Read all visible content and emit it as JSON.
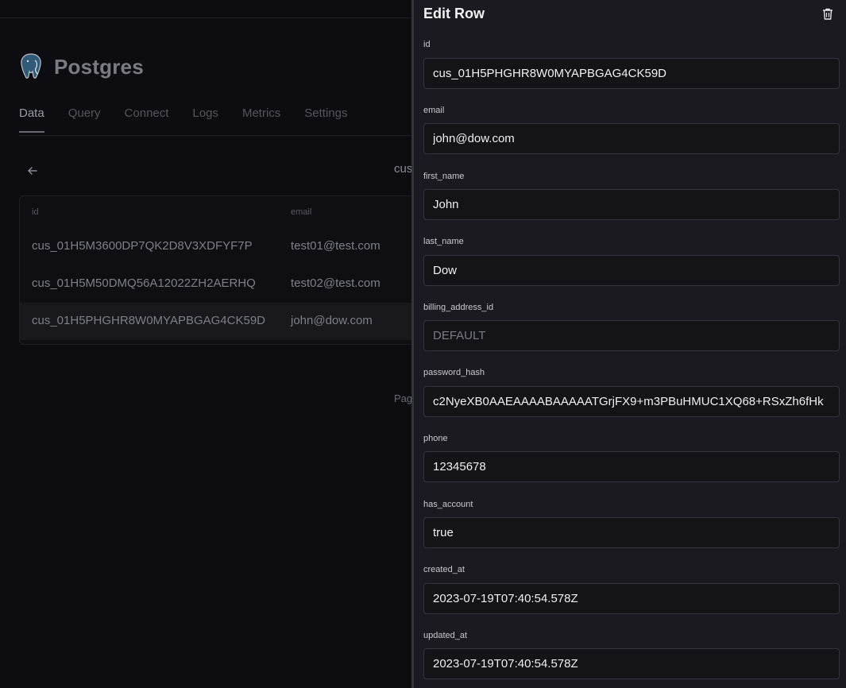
{
  "app": {
    "title": "Postgres",
    "tabs": [
      {
        "label": "Data",
        "active": true
      },
      {
        "label": "Query"
      },
      {
        "label": "Connect"
      },
      {
        "label": "Logs"
      },
      {
        "label": "Metrics"
      },
      {
        "label": "Settings"
      }
    ],
    "table_name_partial": "cus",
    "pagination_partial": "Pag"
  },
  "table": {
    "columns": [
      "id",
      "email"
    ],
    "rows": [
      {
        "id": "cus_01H5M3600DP7QK2D8V3XDFYF7P",
        "email": "test01@test.com"
      },
      {
        "id": "cus_01H5M50DMQ56A12022ZH2AERHQ",
        "email": "test02@test.com"
      },
      {
        "id": "cus_01H5PHGHR8W0MYAPBGAG4CK59D",
        "email": "john@dow.com",
        "selected": true
      }
    ]
  },
  "edit_panel": {
    "title": "Edit Row",
    "fields": [
      {
        "label": "id",
        "value": "cus_01H5PHGHR8W0MYAPBGAG4CK59D",
        "placeholder": ""
      },
      {
        "label": "email",
        "value": "john@dow.com",
        "placeholder": ""
      },
      {
        "label": "first_name",
        "value": "John",
        "placeholder": ""
      },
      {
        "label": "last_name",
        "value": "Dow",
        "placeholder": ""
      },
      {
        "label": "billing_address_id",
        "value": "",
        "placeholder": "DEFAULT"
      },
      {
        "label": "password_hash",
        "value": "c2NyeXB0AAEAAAABAAAAATGrjFX9+m3PBuHMUC1XQ68+RSxZh6fHk",
        "placeholder": ""
      },
      {
        "label": "phone",
        "value": "12345678",
        "placeholder": ""
      },
      {
        "label": "has_account",
        "value": "true",
        "placeholder": ""
      },
      {
        "label": "created_at",
        "value": "2023-07-19T07:40:54.578Z",
        "placeholder": ""
      },
      {
        "label": "updated_at",
        "value": "2023-07-19T07:40:54.578Z",
        "placeholder": ""
      }
    ]
  },
  "icons": {
    "logo": "postgres-elephant-icon",
    "back": "arrow-left-icon",
    "delete": "trash-icon"
  },
  "colors": {
    "background": "#0d0d11",
    "panel": "#1a1a20",
    "field_border": "#34343c"
  }
}
